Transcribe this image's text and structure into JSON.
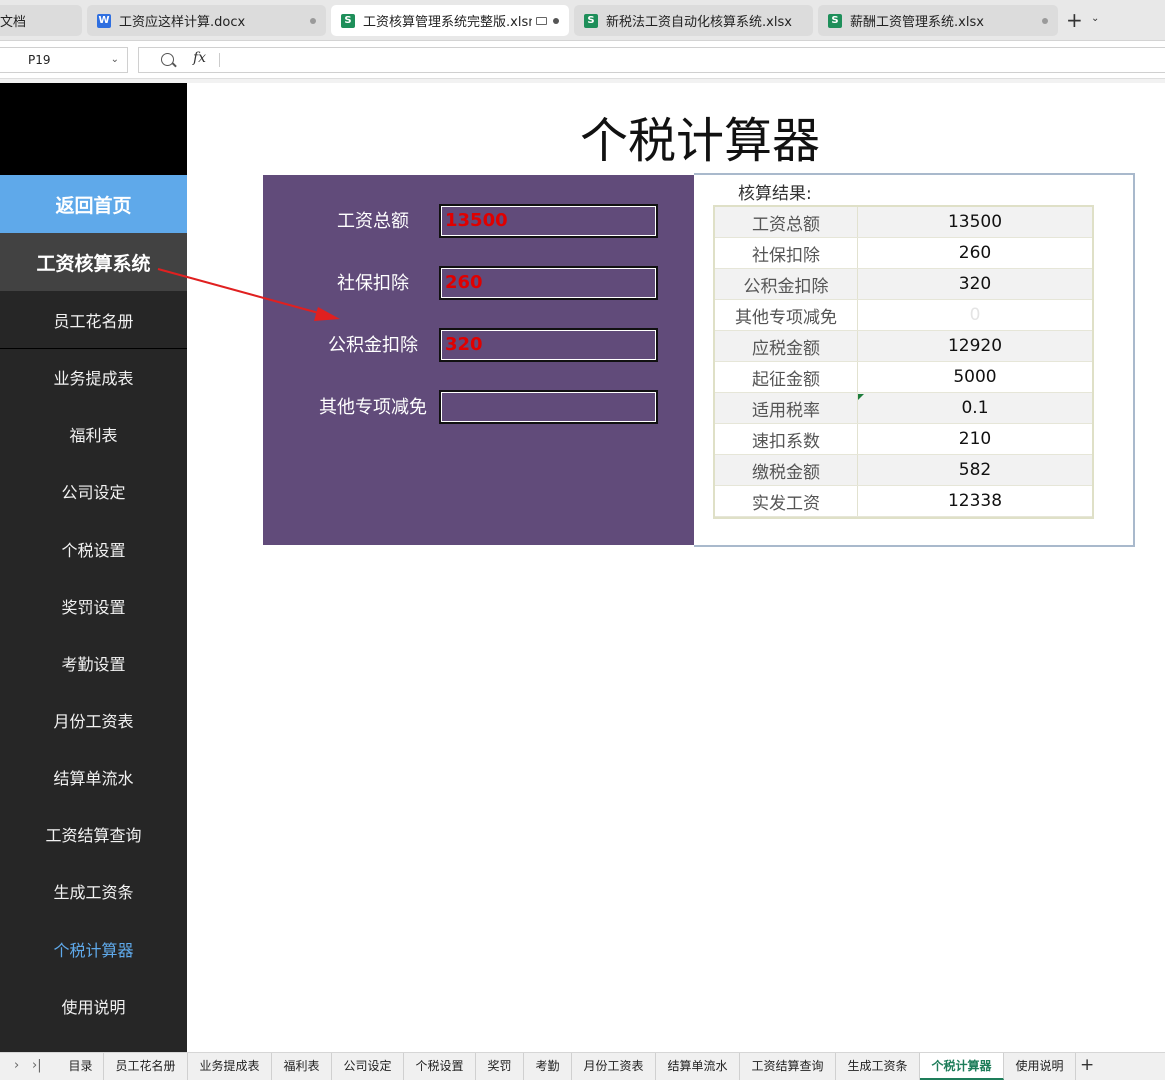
{
  "window_tabs": [
    {
      "icon": "",
      "label": "文档",
      "active": false
    },
    {
      "icon": "W",
      "label": "工资应这样计算.docx",
      "active": false
    },
    {
      "icon": "S",
      "label": "工资核算管理系统完整版.xlsm",
      "active": true
    },
    {
      "icon": "S",
      "label": "新税法工资自动化核算系统.xlsx",
      "active": false
    },
    {
      "icon": "S",
      "label": "薪酬工资管理系统.xlsx",
      "active": false
    }
  ],
  "formula_bar": {
    "cell_ref": "P19",
    "fx_label": "fx",
    "formula": ""
  },
  "sidebar": {
    "home": "返回首页",
    "header": "工资核算系统",
    "items": [
      "员工花名册",
      "业务提成表",
      "福利表",
      "公司设定",
      "个税设置",
      "奖罚设置",
      "考勤设置",
      "月份工资表",
      "结算单流水",
      "工资结算查询",
      "生成工资条",
      "个税计算器",
      "使用说明"
    ],
    "active_item": "个税计算器"
  },
  "sheet_title": "个税计算器",
  "inputs": [
    {
      "label": "工资总额",
      "value": "13500"
    },
    {
      "label": "社保扣除",
      "value": "260"
    },
    {
      "label": "公积金扣除",
      "value": "320"
    },
    {
      "label": "其他专项减免",
      "value": ""
    }
  ],
  "results": {
    "heading": "核算结果:",
    "rows": [
      {
        "label": "工资总额",
        "value": "13500"
      },
      {
        "label": "社保扣除",
        "value": "260"
      },
      {
        "label": "公积金扣除",
        "value": "320"
      },
      {
        "label": "其他专项减免",
        "value": "0"
      },
      {
        "label": "应税金额",
        "value": "12920"
      },
      {
        "label": "起征金额",
        "value": "5000"
      },
      {
        "label": "适用税率",
        "value": "0.1"
      },
      {
        "label": "速扣系数",
        "value": "210"
      },
      {
        "label": "缴税金额",
        "value": "582"
      },
      {
        "label": "实发工资",
        "value": "12338"
      }
    ]
  },
  "sheet_tabs": [
    "目录",
    "员工花名册",
    "业务提成表",
    "福利表",
    "公司设定",
    "个税设置",
    "奖罚",
    "考勤",
    "月份工资表",
    "结算单流水",
    "工资结算查询",
    "生成工资条",
    "个税计算器",
    "使用说明"
  ],
  "active_sheet": "个税计算器",
  "colors": {
    "accent_blue": "#5fa9ea",
    "panel_purple": "#614b7a",
    "input_red": "#e00000",
    "sheet_green": "#1e7d5a",
    "arrow_red": "#e02020"
  }
}
